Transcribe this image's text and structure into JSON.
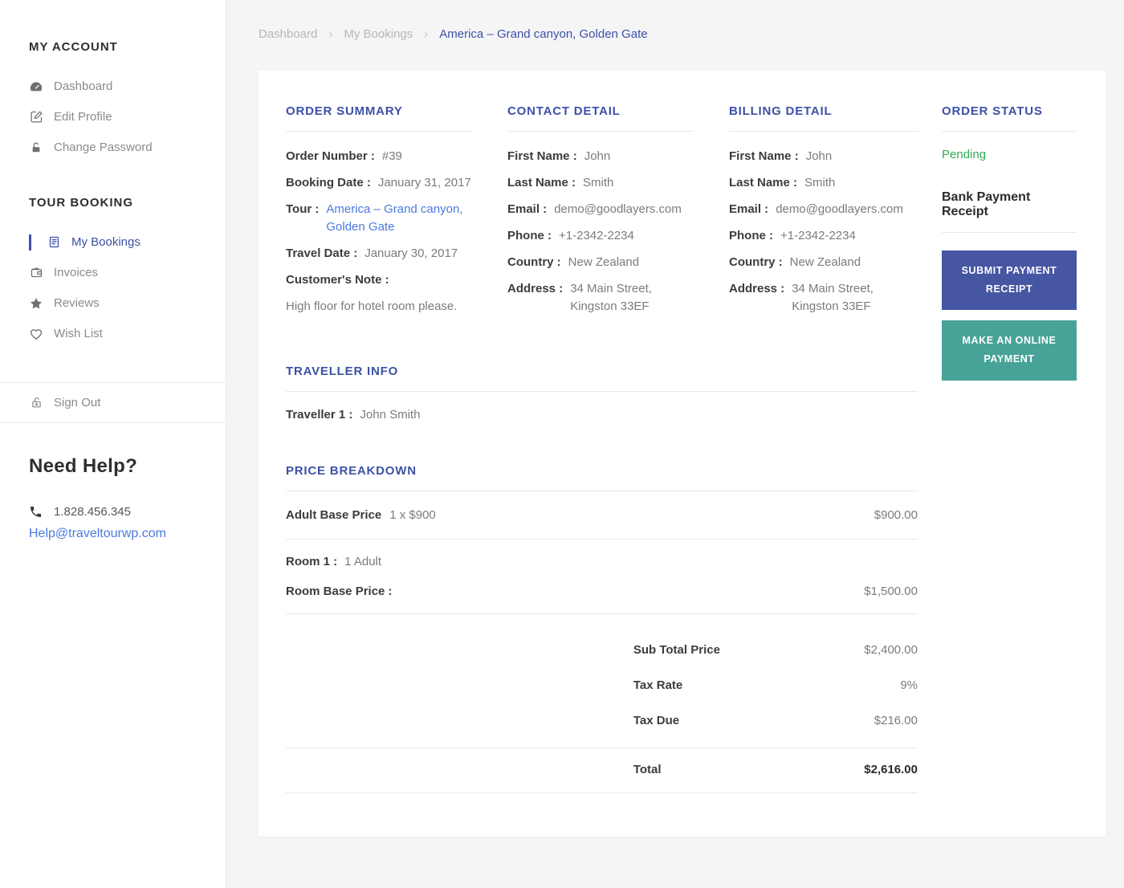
{
  "colors": {
    "accent": "#3c51a6",
    "link": "#4a79e0",
    "pending_green": "#2fad53",
    "submit_button": "#4656a3",
    "online_button": "#47a397"
  },
  "sidebar": {
    "account": {
      "heading": "MY ACCOUNT",
      "items": [
        {
          "label": "Dashboard"
        },
        {
          "label": "Edit Profile"
        },
        {
          "label": "Change Password"
        }
      ]
    },
    "booking": {
      "heading": "TOUR BOOKING",
      "items": [
        {
          "label": "My Bookings"
        },
        {
          "label": "Invoices"
        },
        {
          "label": "Reviews"
        },
        {
          "label": "Wish List"
        }
      ]
    },
    "sign_out_label": "Sign Out",
    "help": {
      "heading": "Need Help?",
      "phone": "1.828.456.345",
      "email": "Help@traveltourwp.com"
    }
  },
  "breadcrumb": {
    "separator": "›",
    "items": [
      {
        "label": "Dashboard"
      },
      {
        "label": "My Bookings"
      },
      {
        "label": "America – Grand canyon, Golden Gate"
      }
    ]
  },
  "order_summary": {
    "title": "ORDER SUMMARY",
    "order_number_label": "Order Number :",
    "order_number": "#39",
    "booking_date_label": "Booking Date :",
    "booking_date": "January 31, 2017",
    "tour_label": "Tour :",
    "tour": "America – Grand canyon, Golden Gate",
    "travel_date_label": "Travel Date :",
    "travel_date": "January 30, 2017",
    "customer_note_label": "Customer's Note :",
    "customer_note": "High floor for hotel room please."
  },
  "contact_detail": {
    "title": "CONTACT DETAIL",
    "fields": [
      {
        "label": "First Name :",
        "value": "John"
      },
      {
        "label": "Last Name :",
        "value": "Smith"
      },
      {
        "label": "Email :",
        "value": "demo@goodlayers.com"
      },
      {
        "label": "Phone :",
        "value": "+1-2342-2234"
      },
      {
        "label": "Country :",
        "value": "New Zealand"
      },
      {
        "label": "Address :",
        "value": "34 Main Street,\nKingston 33EF"
      }
    ]
  },
  "billing_detail": {
    "title": "BILLING DETAIL",
    "fields": [
      {
        "label": "First Name :",
        "value": "John"
      },
      {
        "label": "Last Name :",
        "value": "Smith"
      },
      {
        "label": "Email :",
        "value": "demo@goodlayers.com"
      },
      {
        "label": "Phone :",
        "value": "+1-2342-2234"
      },
      {
        "label": "Country :",
        "value": "New Zealand"
      },
      {
        "label": "Address :",
        "value": "34 Main Street,\nKingston 33EF"
      }
    ]
  },
  "order_status": {
    "title": "ORDER STATUS",
    "status": "Pending",
    "receipt_label": "Bank Payment Receipt",
    "submit_button": "SUBMIT PAYMENT RECEIPT",
    "online_button": "MAKE AN ONLINE PAYMENT"
  },
  "traveller_info": {
    "title": "TRAVELLER INFO",
    "label": "Traveller 1 :",
    "value": "John Smith"
  },
  "price_breakdown": {
    "title": "PRICE BREAKDOWN",
    "adult_base_label": "Adult Base Price",
    "adult_base_qty": "1 x $900",
    "adult_base_amount": "$900.00",
    "room_label": "Room 1 :",
    "room_value": "1 Adult",
    "room_base_label": "Room Base Price :",
    "room_base_amount": "$1,500.00",
    "subtotal_label": "Sub Total Price",
    "subtotal": "$2,400.00",
    "tax_rate_label": "Tax Rate",
    "tax_rate": "9%",
    "tax_due_label": "Tax Due",
    "tax_due": "$216.00",
    "total_label": "Total",
    "total": "$2,616.00"
  }
}
